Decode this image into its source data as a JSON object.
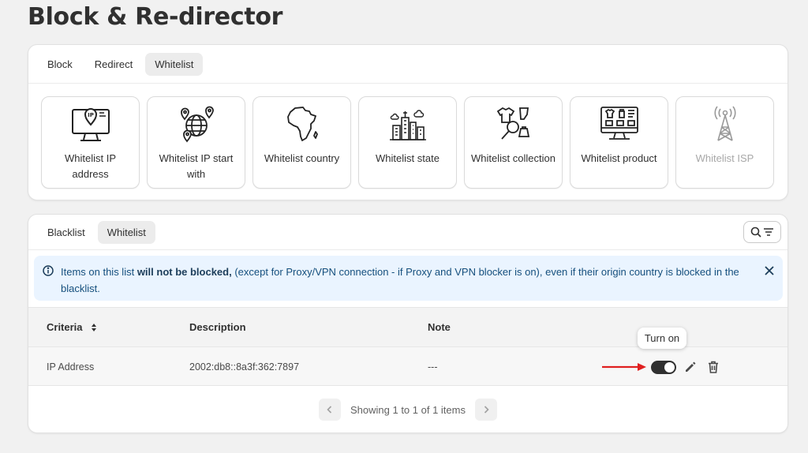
{
  "page": {
    "title": "Block & Re-director"
  },
  "top_tabs": [
    {
      "label": "Block",
      "active": false
    },
    {
      "label": "Redirect",
      "active": false
    },
    {
      "label": "Whitelist",
      "active": true
    }
  ],
  "tiles": [
    {
      "label": "Whitelist IP address",
      "icon": "monitor-ip-icon",
      "disabled": false
    },
    {
      "label": "Whitelist IP start with",
      "icon": "globe-pins-icon",
      "disabled": false
    },
    {
      "label": "Whitelist country",
      "icon": "africa-map-icon",
      "disabled": false
    },
    {
      "label": "Whitelist state",
      "icon": "city-skyline-icon",
      "disabled": false
    },
    {
      "label": "Whitelist collection",
      "icon": "clothes-magnifier-icon",
      "disabled": false
    },
    {
      "label": "Whitelist product",
      "icon": "monitor-products-icon",
      "disabled": false
    },
    {
      "label": "Whitelist ISP",
      "icon": "radio-tower-icon",
      "disabled": true
    }
  ],
  "list_tabs": [
    {
      "label": "Blacklist",
      "active": false
    },
    {
      "label": "Whitelist",
      "active": true
    }
  ],
  "banner": {
    "text_before": "Items on this list ",
    "text_bold": "will not be blocked,",
    "text_after": " (except for Proxy/VPN connection - if Proxy and VPN blocker is on), even if their origin country is blocked in the blacklist."
  },
  "table": {
    "headers": {
      "criteria": "Criteria",
      "description": "Description",
      "note": "Note"
    },
    "rows": [
      {
        "criteria": "IP Address",
        "description": "2002:db8::8a3f:362:7897",
        "note": "---"
      }
    ]
  },
  "tooltip": {
    "text": "Turn on"
  },
  "pagination": {
    "text": "Showing 1 to 1 of 1 items"
  },
  "colors": {
    "annotation_arrow": "#e02020",
    "banner_bg": "#eaf4ff",
    "toggle": "#303030"
  }
}
